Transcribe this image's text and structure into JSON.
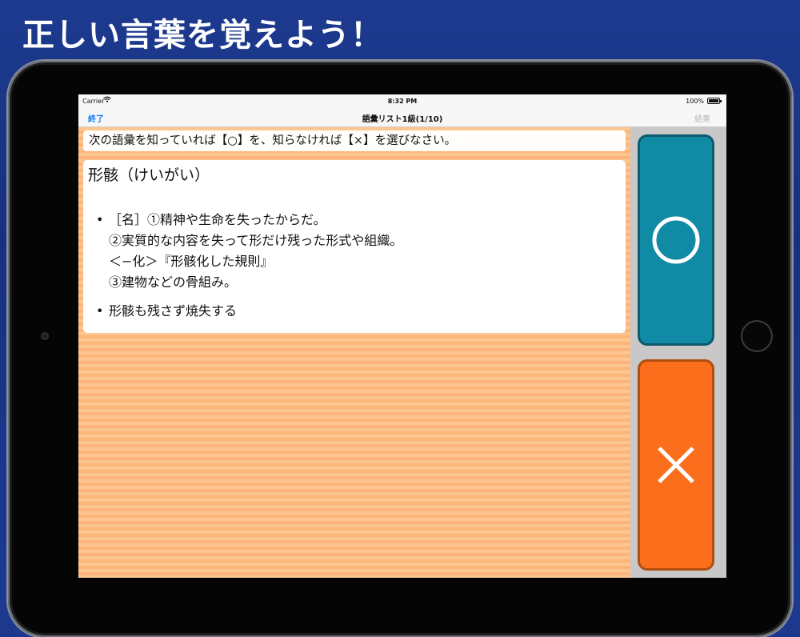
{
  "headline": "正しい言葉を覚えよう！",
  "status_bar": {
    "carrier": "Carrier",
    "wifi_icon": "wifi-icon",
    "time": "8:32 PM",
    "battery": "100%"
  },
  "nav": {
    "done_label": "終了",
    "title": "語彙リスト1級(1/10)",
    "result_label": "結果"
  },
  "instruction": "次の語彙を知っていれば【○】を、知らなければ【×】を選びなさい。",
  "card": {
    "word": "形骸（けいがい）",
    "definitions": [
      {
        "bullet": "•",
        "lines": [
          "［名］①精神や生命を失ったからだ。",
          "②実質的な内容を失って形だけ残った形式や組織。",
          "＜−化＞『形骸化した規則』",
          "③建物などの骨組み。"
        ]
      },
      {
        "bullet": "•",
        "lines": [
          "形骸も残さず焼失する"
        ]
      }
    ]
  },
  "buttons": {
    "know": {
      "icon": "circle-icon",
      "color": "#118aa6"
    },
    "dont_know": {
      "icon": "cross-icon",
      "color": "#fb6e1c"
    }
  }
}
